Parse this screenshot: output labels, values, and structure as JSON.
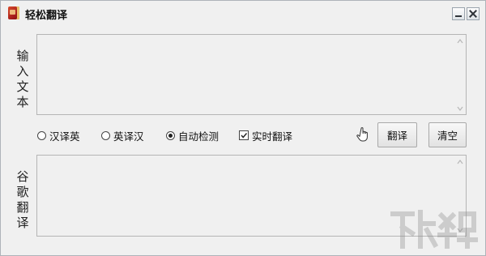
{
  "window": {
    "title": "轻松翻译",
    "icon": "book-icon"
  },
  "labels": {
    "input": "输入文本",
    "output": "谷歌翻译"
  },
  "input_box": {
    "value": ""
  },
  "output_box": {
    "value": ""
  },
  "options": {
    "radios": [
      {
        "label": "汉译英",
        "checked": false
      },
      {
        "label": "英译汉",
        "checked": false
      },
      {
        "label": "自动检测",
        "checked": true
      }
    ],
    "realtime": {
      "label": "实时翻译",
      "checked": true
    }
  },
  "buttons": {
    "translate": "翻译",
    "clear": "清空"
  },
  "icons": {
    "hand": "hand-pointer-icon",
    "minimize": "minimize-icon",
    "close": "close-icon"
  }
}
